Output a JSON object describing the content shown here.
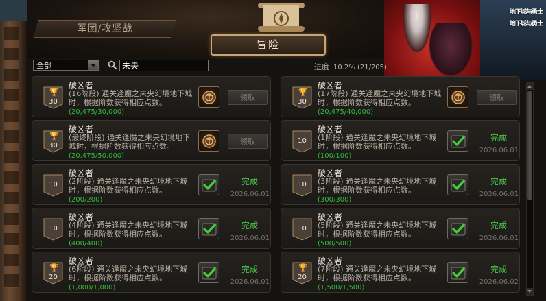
{
  "header": {
    "tab_guild": "军团/攻坚战",
    "tab_adventure": "冒险"
  },
  "banner": {
    "logo_line1": "地下城与勇士",
    "logo_line2": "地下城与勇士"
  },
  "filter": {
    "category": "全部",
    "search_value": "未央"
  },
  "progress": {
    "label": "进度",
    "value": "10.2% (21/205)"
  },
  "achievements": [
    {
      "title": "破凶者",
      "desc": "(16阶段) 通关逢魔之未央幻境地下城时，根据阶数获得相应点数。",
      "progress": "(20,475/30,000)",
      "points": "30",
      "badge": "trophy",
      "reward": "emblem",
      "status": "claim",
      "action": "领取"
    },
    {
      "title": "破凶者",
      "desc": "(17阶段) 通关逢魔之未央幻境地下城时，根据阶数获得相应点数。",
      "progress": "(20,475/40,000)",
      "points": "30",
      "badge": "trophy",
      "reward": "emblem",
      "status": "claim",
      "action": "领取"
    },
    {
      "title": "破凶者",
      "desc": "(最终阶段) 通关逢魔之未央幻境地下城时，根据阶数获得相应点数。",
      "progress": "(20,475/50,000)",
      "points": "30",
      "badge": "trophy",
      "reward": "emblem",
      "status": "claim",
      "action": "领取"
    },
    {
      "title": "破凶者",
      "desc": "(1阶段) 通关逢魔之未央幻境地下城时，根据阶数获得相应点数。",
      "progress": "(100/100)",
      "points": "10",
      "badge": "plain",
      "reward": "check",
      "status": "done",
      "action": "完成",
      "date": "2026.06.01"
    },
    {
      "title": "破凶者",
      "desc": "(2阶段) 通关逢魔之未央幻境地下城时，根据阶数获得相应点数。",
      "progress": "(200/200)",
      "points": "10",
      "badge": "plain",
      "reward": "check",
      "status": "done",
      "action": "完成",
      "date": "2026.06.01"
    },
    {
      "title": "破凶者",
      "desc": "(3阶段) 通关逢魔之未央幻境地下城时，根据阶数获得相应点数。",
      "progress": "(300/300)",
      "points": "10",
      "badge": "plain",
      "reward": "check",
      "status": "done",
      "action": "完成",
      "date": "2026.06.01"
    },
    {
      "title": "破凶者",
      "desc": "(4阶段) 通关逢魔之未央幻境地下城时，根据阶数获得相应点数。",
      "progress": "(400/400)",
      "points": "10",
      "badge": "plain",
      "reward": "check",
      "status": "done",
      "action": "完成",
      "date": "2026.06.01"
    },
    {
      "title": "破凶者",
      "desc": "(5阶段) 通关逢魔之未央幻境地下城时，根据阶数获得相应点数。",
      "progress": "(500/500)",
      "points": "10",
      "badge": "plain",
      "reward": "check",
      "status": "done",
      "action": "完成",
      "date": "2026.06.01"
    },
    {
      "title": "破凶者",
      "desc": "(6阶段) 通关逢魔之未央幻境地下城时，根据阶数获得相应点数。",
      "progress": "(1,000/1,000)",
      "points": "20",
      "badge": "trophy",
      "reward": "check",
      "status": "done",
      "action": "完成",
      "date": "2026.06.01"
    },
    {
      "title": "破凶者",
      "desc": "(7阶段) 通关逢魔之未央幻境地下城时，根据阶数获得相应点数。",
      "progress": "(1,500/1,500)",
      "points": "20",
      "badge": "trophy",
      "reward": "check",
      "status": "done",
      "action": "完成",
      "date": "2026.06.02"
    }
  ],
  "colors": {
    "complete_green": "#49c34a",
    "frame_gold": "#caa574",
    "panel_bg": "#151310"
  }
}
